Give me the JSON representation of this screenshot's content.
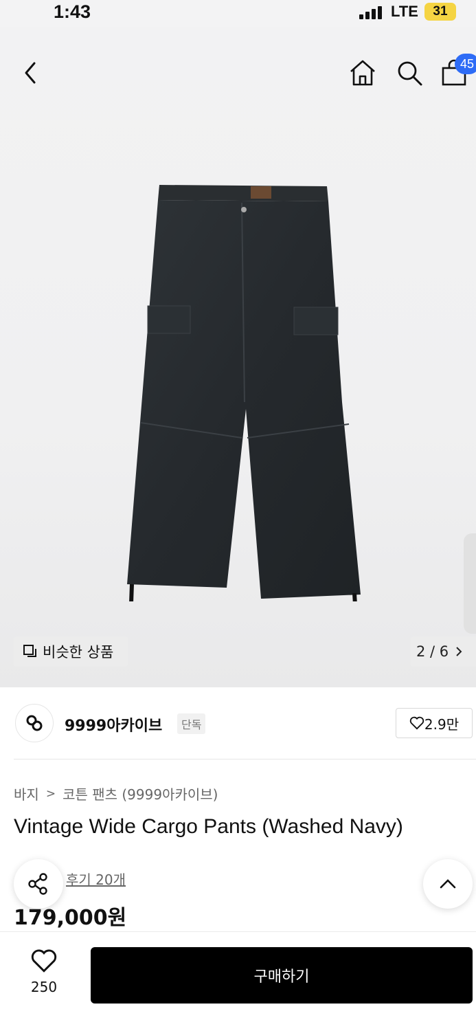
{
  "status_bar": {
    "time": "1:43",
    "network": "LTE",
    "battery": "31"
  },
  "header": {
    "cart_count": "45"
  },
  "gallery": {
    "similar_label": "비슷한 상품",
    "pager": "2 / 6"
  },
  "brand": {
    "name": "9999아카이브",
    "tag": "단독",
    "likes": "2.9만"
  },
  "product": {
    "breadcrumb": [
      "바지",
      "코튼 팬츠 (9999아카이브)"
    ],
    "title": "Vintage Wide Cargo Pants (Washed Navy)",
    "reviews": "후기 20개",
    "price": "179,000원"
  },
  "bottom": {
    "wish_count": "250",
    "buy_label": "구매하기"
  },
  "colors": {
    "accent": "#2e6cf6",
    "buy_button": "#000000",
    "battery": "#f5d443"
  }
}
